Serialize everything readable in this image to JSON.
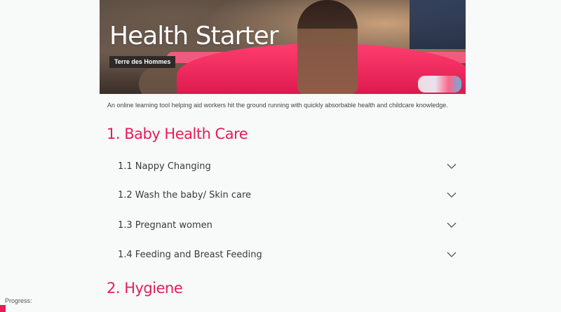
{
  "hero": {
    "title": "Health Starter",
    "badge": "Terre des Hommes"
  },
  "intro": "An online learning tool helping aid workers hit the ground running with quickly absorbable health and childcare knowledge.",
  "sections": [
    {
      "title": "1. Baby Health Care",
      "items": [
        {
          "label": "1.1 Nappy Changing",
          "icon": "chevron-down-icon"
        },
        {
          "label": "1.2 Wash the baby/ Skin care",
          "icon": "chevron-down-icon"
        },
        {
          "label": "1.3 Pregnant women",
          "icon": "chevron-down-icon"
        },
        {
          "label": "1.4 Feeding and Breast Feeding",
          "icon": "chevron-down-icon"
        }
      ]
    },
    {
      "title": "2. Hygiene",
      "items": []
    }
  ],
  "progress": {
    "label": "Progress:",
    "value": 0.01
  },
  "colors": {
    "accent": "#e61d56",
    "background": "#f8f9f9",
    "badge": "#2f2a28",
    "text": "#3a3a3a"
  }
}
